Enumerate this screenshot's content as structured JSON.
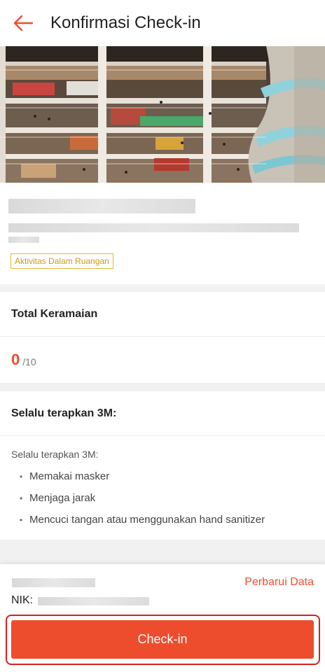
{
  "header": {
    "title": "Konfirmasi Check-in",
    "back_icon": "arrow-left-icon",
    "accent": "#ee4d2d"
  },
  "location": {
    "tag": "Aktivitas Dalam Ruangan"
  },
  "crowd": {
    "title": "Total Keramaian",
    "current": "0",
    "max": "/10"
  },
  "rules": {
    "title": "Selalu terapkan 3M:",
    "intro": "Selalu terapkan 3M:",
    "items": [
      "Memakai masker",
      "Menjaga jarak",
      "Mencuci tangan atau menggunakan hand sanitizer"
    ]
  },
  "footer": {
    "update_label": "Perbarui Data",
    "nik_label": "NIK:",
    "checkin_label": "Check-in"
  }
}
